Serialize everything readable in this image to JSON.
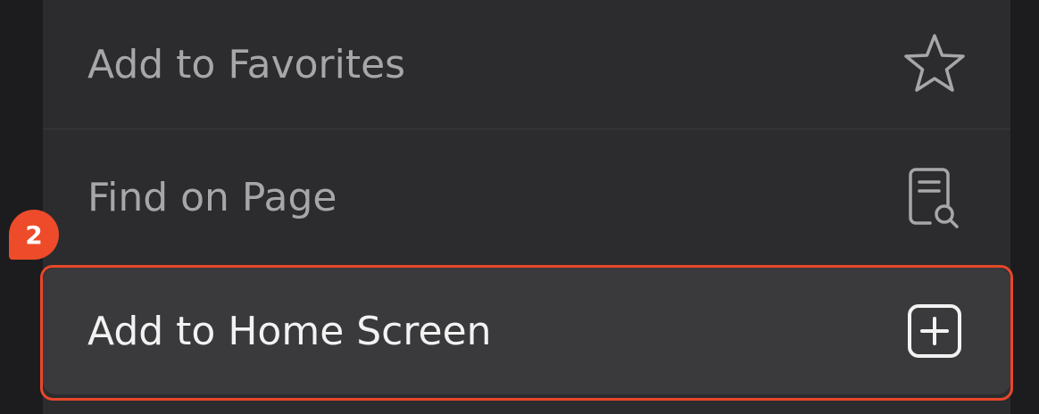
{
  "menu": {
    "items": [
      {
        "label": "Add to Favorites",
        "icon": "star-icon"
      },
      {
        "label": "Find on Page",
        "icon": "find-on-page-icon"
      },
      {
        "label": "Add to Home Screen",
        "icon": "add-square-icon",
        "highlighted": true
      }
    ]
  },
  "annotation": {
    "step_number": "2",
    "color": "#ed4b29"
  },
  "colors": {
    "menu_background": "#2c2c2e",
    "highlighted_item_background": "#3a3a3c",
    "page_background": "#1c1c1e",
    "label_dim": "#a7a7a9",
    "label_bright": "#f2f2f2"
  }
}
